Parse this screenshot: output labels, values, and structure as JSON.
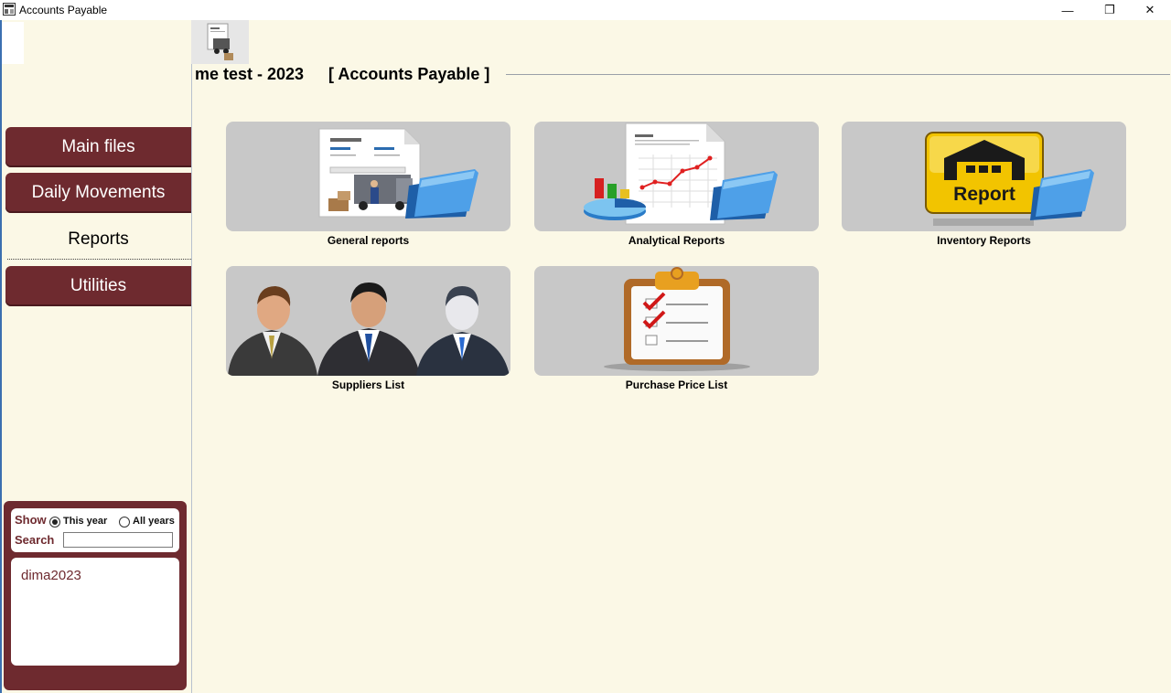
{
  "window": {
    "title": "Accounts  Payable",
    "minimize_glyph": "—",
    "maximize_glyph": "❐",
    "close_glyph": "✕"
  },
  "header": {
    "company": "me test - 2023",
    "module": "[ Accounts  Payable ]"
  },
  "nav": {
    "items": [
      {
        "label": "Main files"
      },
      {
        "label": "Daily Movements"
      },
      {
        "label": "Reports"
      },
      {
        "label": "Utilities"
      }
    ],
    "active": "Reports"
  },
  "search_panel": {
    "show_label": "Show",
    "this_year": "This year",
    "all_years": "All years",
    "search_label": "Search",
    "search_value": "",
    "list": [
      "dima2023"
    ]
  },
  "tiles": [
    {
      "label": "General reports",
      "icon": "invoice-folder-icon"
    },
    {
      "label": "Analytical Reports",
      "icon": "analytics-folder-icon"
    },
    {
      "label": "Inventory Reports",
      "icon": "inventory-report-folder-icon"
    },
    {
      "label": "Suppliers List",
      "icon": "suppliers-people-icon"
    },
    {
      "label": "Purchase  Price List",
      "icon": "clipboard-checklist-icon"
    }
  ],
  "colors": {
    "accent": "#6e2a2f",
    "background": "#fbf8e6",
    "tile": "#c8c8c8"
  }
}
